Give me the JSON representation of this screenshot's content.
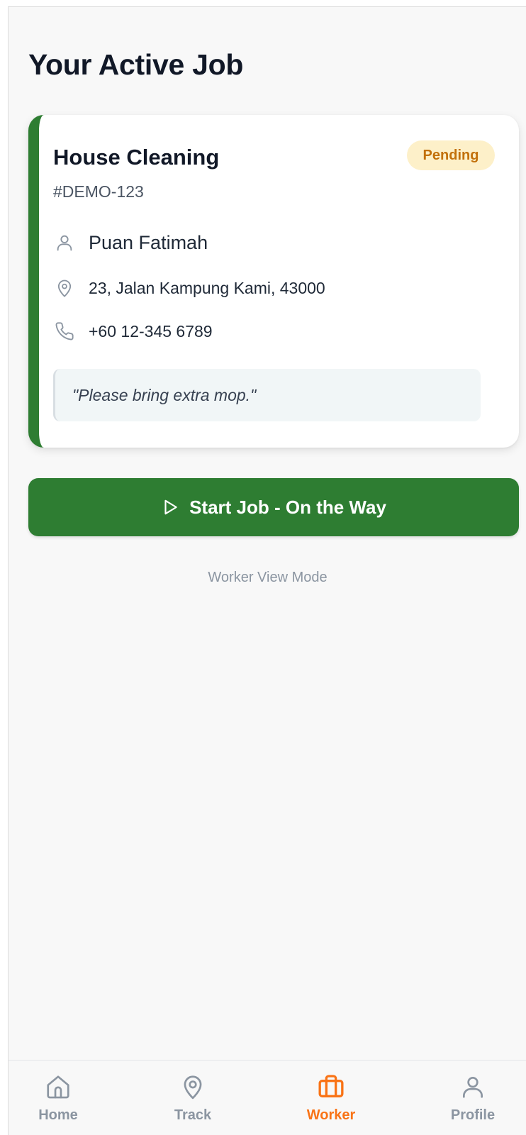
{
  "page": {
    "title": "Your Active Job"
  },
  "job": {
    "title": "House Cleaning",
    "status": "Pending",
    "id": "#DEMO-123",
    "customer_name": "Puan Fatimah",
    "address": "23, Jalan Kampung Kami, 43000",
    "phone": "+60 12-345 6789",
    "note": "\"Please bring extra mop.\""
  },
  "actions": {
    "start_label": "Start Job - On the Way"
  },
  "mode_caption": "Worker View Mode",
  "nav": {
    "items": [
      {
        "label": "Home",
        "icon": "home-icon"
      },
      {
        "label": "Track",
        "icon": "map-pin-icon"
      },
      {
        "label": "Worker",
        "icon": "briefcase-icon",
        "active": true
      },
      {
        "label": "Profile",
        "icon": "user-icon"
      }
    ]
  },
  "colors": {
    "accent_green": "#2e7d32",
    "badge_bg": "#fdf0c9",
    "badge_text": "#c2700a",
    "nav_active": "#f97316",
    "nav_inactive": "#8b95a1"
  }
}
